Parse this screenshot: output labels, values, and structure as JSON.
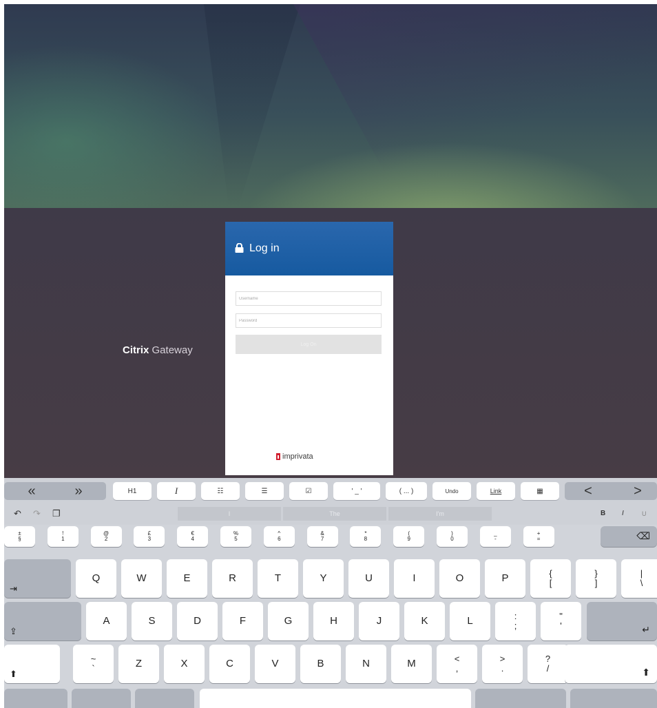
{
  "login": {
    "title": "Log in",
    "username_placeholder": "Username",
    "password_placeholder": "Password",
    "button_label": "Log On",
    "footer_brand": "imprivata"
  },
  "brand": {
    "bold": "Citrix",
    "light": "Gateway"
  },
  "keyboard": {
    "toolbar": {
      "back": "«",
      "forward": "»",
      "heading": "H1",
      "italic": "I",
      "bullets": "☷",
      "numbers": "☰",
      "checkbox": "☑",
      "quote": "' _ '",
      "paren": "( ... )",
      "undo": "Undo",
      "link": "Link",
      "table": "▦",
      "prev": "<",
      "next": ">"
    },
    "predictions": [
      "I",
      "The",
      "I'm"
    ],
    "predict_icons": {
      "undo": "↶",
      "redo": "↷",
      "paste": "❐",
      "bold": "B",
      "italic": "I",
      "underline": "U"
    },
    "number_row": [
      {
        "top": "±",
        "bottom": "§"
      },
      {
        "top": "!",
        "bottom": "1"
      },
      {
        "top": "@",
        "bottom": "2"
      },
      {
        "top": "£",
        "bottom": "3"
      },
      {
        "top": "€",
        "bottom": "4"
      },
      {
        "top": "%",
        "bottom": "5"
      },
      {
        "top": "^",
        "bottom": "6"
      },
      {
        "top": "&",
        "bottom": "7"
      },
      {
        "top": "*",
        "bottom": "8"
      },
      {
        "top": "(",
        "bottom": "9"
      },
      {
        "top": ")",
        "bottom": "0"
      },
      {
        "top": "_",
        "bottom": "-"
      },
      {
        "top": "+",
        "bottom": "="
      }
    ],
    "row_q": [
      "Q",
      "W",
      "E",
      "R",
      "T",
      "Y",
      "U",
      "I",
      "O",
      "P"
    ],
    "row_q_sym": [
      {
        "top": "{",
        "bottom": "["
      },
      {
        "top": "}",
        "bottom": "]"
      },
      {
        "top": "|",
        "bottom": "\\"
      }
    ],
    "row_a": [
      "A",
      "S",
      "D",
      "F",
      "G",
      "H",
      "J",
      "K",
      "L"
    ],
    "row_a_sym": [
      {
        "top": ":",
        "bottom": ";"
      },
      {
        "top": "\"",
        "bottom": "'"
      }
    ],
    "row_z": [
      "Z",
      "X",
      "C",
      "V",
      "B",
      "N",
      "M"
    ],
    "row_z_pre": {
      "top": "~",
      "bottom": "`"
    },
    "row_z_sym": [
      {
        "top": "<",
        "bottom": ","
      },
      {
        "top": ">",
        "bottom": "."
      },
      {
        "top": "?",
        "bottom": "/"
      }
    ],
    "icons": {
      "tab": "⇥",
      "caps": "⇪",
      "shift": "⬆",
      "return": "↵",
      "delete": "⌫"
    }
  }
}
